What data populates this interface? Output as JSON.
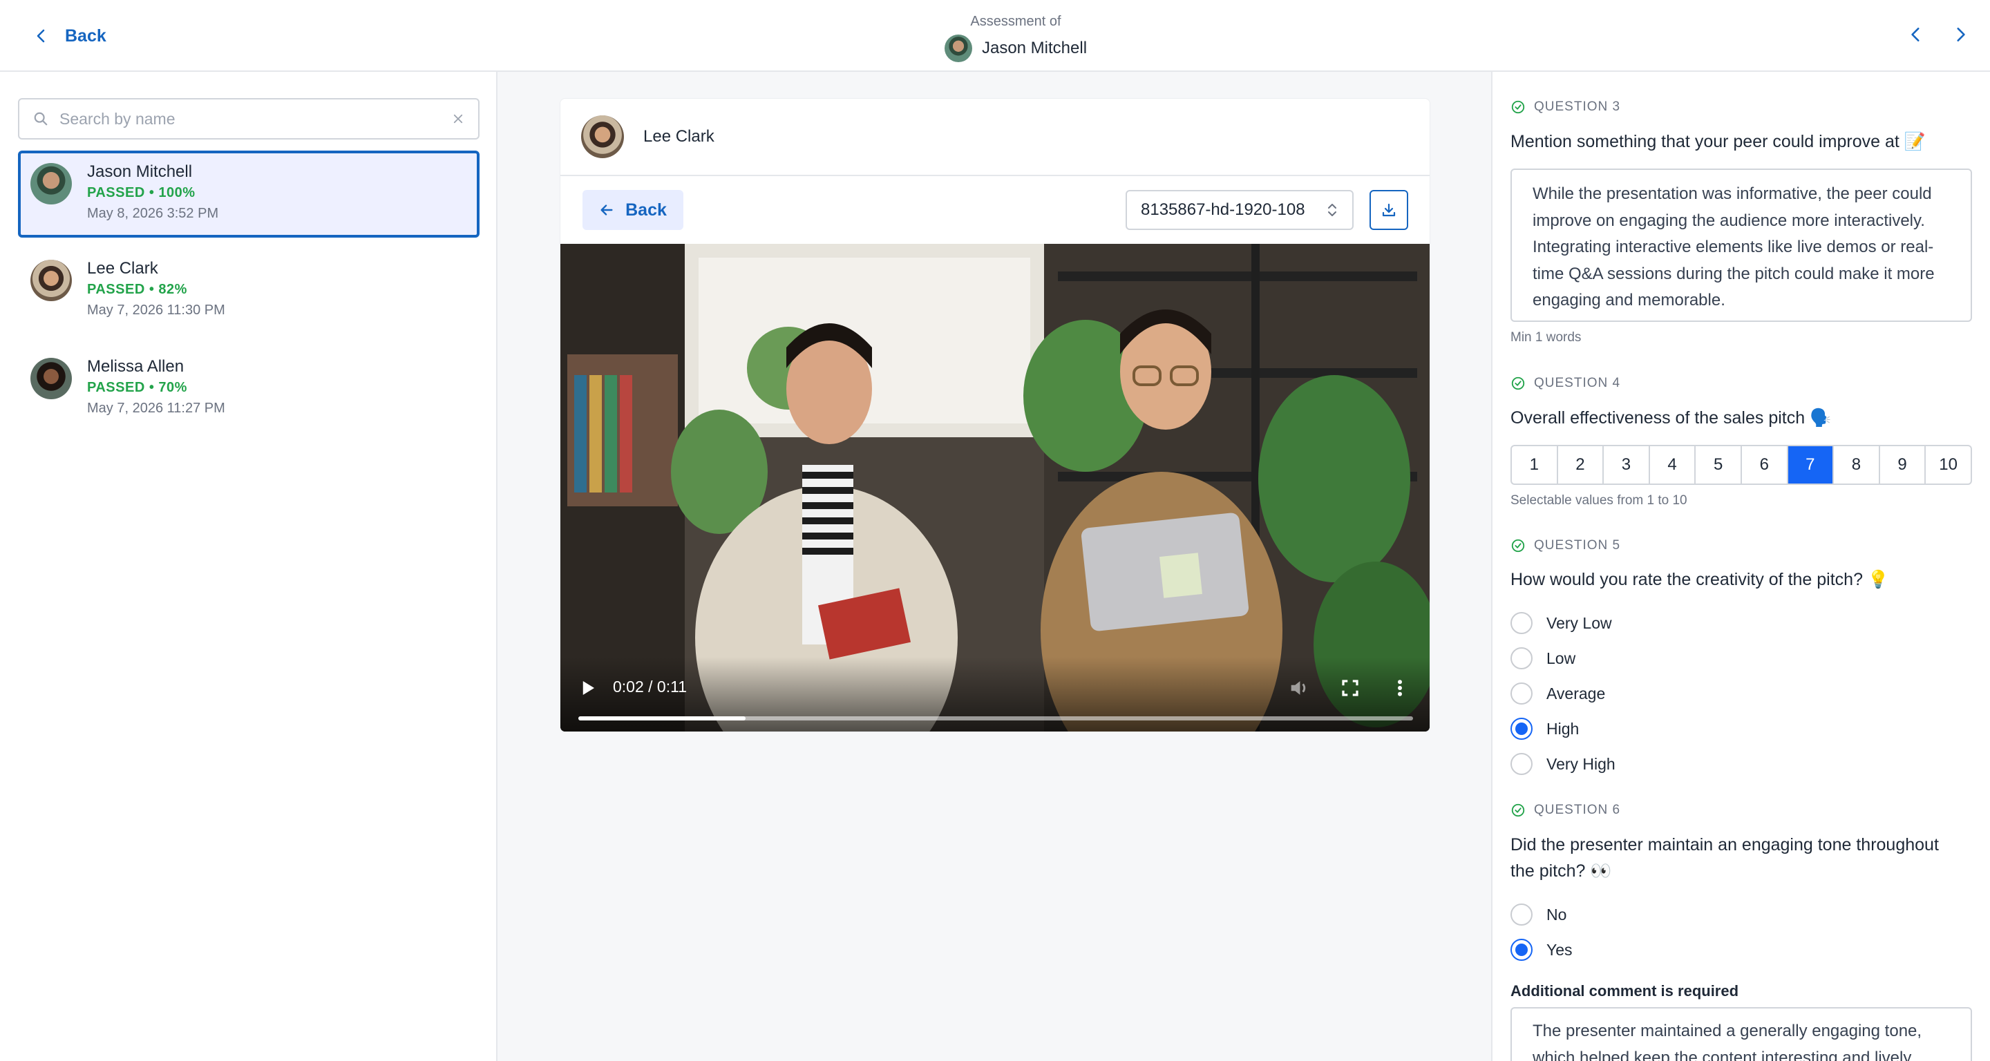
{
  "header": {
    "back_label": "Back",
    "subtitle": "Assessment of",
    "person_name": "Jason Mitchell"
  },
  "sidebar": {
    "search_placeholder": "Search by name",
    "people": [
      {
        "name": "Jason Mitchell",
        "status": "PASSED • 100%",
        "date": "May 8, 2026 3:52 PM",
        "selected": true
      },
      {
        "name": "Lee Clark",
        "status": "PASSED • 82%",
        "date": "May 7, 2026 11:30 PM",
        "selected": false
      },
      {
        "name": "Melissa Allen",
        "status": "PASSED • 70%",
        "date": "May 7, 2026 11:27 PM",
        "selected": false
      }
    ]
  },
  "center": {
    "reviewer_name": "Lee Clark",
    "back_label": "Back",
    "file_select_value": "8135867-hd-1920-108",
    "video": {
      "time": "0:02 / 0:11",
      "progress": 0.2
    }
  },
  "questions": {
    "q3": {
      "label": "QUESTION 3",
      "text": "Mention something that your peer could improve at 📝",
      "answer": "While the presentation was informative, the peer could improve on engaging the audience more interactively. Integrating interactive elements like live demos or real-time Q&A sessions during the pitch could make it more engaging and memorable.",
      "hint": "Min 1 words"
    },
    "q4": {
      "label": "QUESTION 4",
      "text": "Overall effectiveness of the sales pitch 🗣️",
      "options": [
        "1",
        "2",
        "3",
        "4",
        "5",
        "6",
        "7",
        "8",
        "9",
        "10"
      ],
      "selected": "7",
      "hint": "Selectable values from 1 to 10"
    },
    "q5": {
      "label": "QUESTION 5",
      "text": "How would you rate the creativity of the pitch? 💡",
      "options": [
        "Very Low",
        "Low",
        "Average",
        "High",
        "Very High"
      ],
      "selected": "High"
    },
    "q6": {
      "label": "QUESTION 6",
      "text": "Did the presenter maintain an engaging tone throughout the pitch? 👀",
      "options": [
        "No",
        "Yes"
      ],
      "selected": "Yes",
      "comment_label": "Additional comment is required",
      "comment": "The presenter maintained a generally engaging tone, which helped keep the content interesting and lively."
    }
  },
  "colors": {
    "accent": "#1565c0",
    "selected_fill": "#1565f5",
    "pass_green": "#22a34a"
  }
}
